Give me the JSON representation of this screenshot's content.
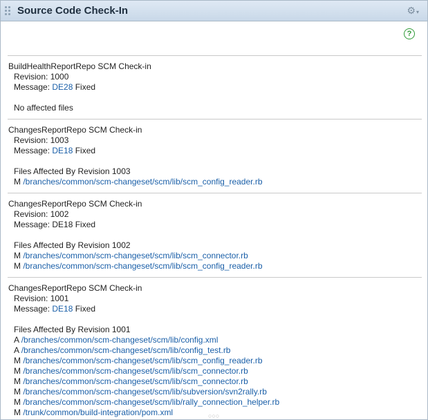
{
  "panel": {
    "title": "Source Code Check-In",
    "gear_icon": "gear-icon",
    "gear_caret": "▾",
    "help_icon": "?"
  },
  "entries": [
    {
      "repo": "BuildHealthReportRepo SCM Check-in",
      "revision": "Revision: 1000",
      "message_prefix": "Message: ",
      "message_link": "DE28",
      "message_suffix": " Fixed",
      "files_heading": "No affected files",
      "files": []
    },
    {
      "repo": "ChangesReportRepo SCM Check-in",
      "revision": "Revision: 1003",
      "message_prefix": "Message: ",
      "message_link": "DE18",
      "message_suffix": " Fixed",
      "files_heading": "Files Affected By Revision 1003",
      "files": [
        {
          "action": "M",
          "path": "/branches/common/scm-changeset/scm/lib/scm_config_reader.rb"
        }
      ]
    },
    {
      "repo": "ChangesReportRepo SCM Check-in",
      "revision": "Revision: 1002",
      "message_prefix": "Message: DE18 Fixed",
      "message_link": "",
      "message_suffix": "",
      "files_heading": "Files Affected By Revision 1002",
      "files": [
        {
          "action": "M",
          "path": "/branches/common/scm-changeset/scm/lib/scm_connector.rb"
        },
        {
          "action": "M",
          "path": "/branches/common/scm-changeset/scm/lib/scm_config_reader.rb"
        }
      ]
    },
    {
      "repo": "ChangesReportRepo SCM Check-in",
      "revision": "Revision: 1001",
      "message_prefix": "Message: ",
      "message_link": "DE18",
      "message_suffix": " Fixed",
      "files_heading": "Files Affected By Revision 1001",
      "files": [
        {
          "action": "A",
          "path": "/branches/common/scm-changeset/scm/lib/config.xml"
        },
        {
          "action": "A",
          "path": "/branches/common/scm-changeset/scm/lib/config_test.rb"
        },
        {
          "action": "M",
          "path": "/branches/common/scm-changeset/scm/lib/scm_config_reader.rb"
        },
        {
          "action": "M",
          "path": "/branches/common/scm-changeset/scm/lib/scm_connector.rb"
        },
        {
          "action": "M",
          "path": "/branches/common/scm-changeset/scm/lib/scm_connector.rb"
        },
        {
          "action": "M",
          "path": "/branches/common/scm-changeset/scm/lib/subversion/svn2rally.rb"
        },
        {
          "action": "M",
          "path": "/branches/common/scm-changeset/scm/lib/rally_connection_helper.rb"
        },
        {
          "action": "M",
          "path": "/trunk/common/build-integration/pom.xml"
        }
      ]
    }
  ]
}
